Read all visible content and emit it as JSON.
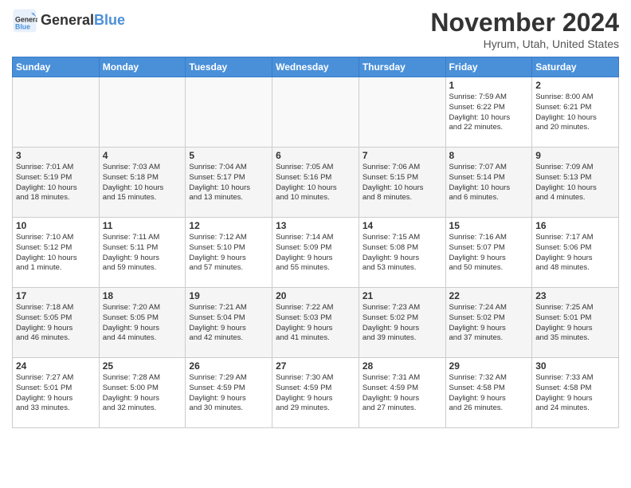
{
  "header": {
    "logo_line1": "General",
    "logo_line2": "Blue",
    "month": "November 2024",
    "location": "Hyrum, Utah, United States"
  },
  "columns": [
    "Sunday",
    "Monday",
    "Tuesday",
    "Wednesday",
    "Thursday",
    "Friday",
    "Saturday"
  ],
  "weeks": [
    [
      {
        "day": "",
        "info": ""
      },
      {
        "day": "",
        "info": ""
      },
      {
        "day": "",
        "info": ""
      },
      {
        "day": "",
        "info": ""
      },
      {
        "day": "",
        "info": ""
      },
      {
        "day": "1",
        "info": "Sunrise: 7:59 AM\nSunset: 6:22 PM\nDaylight: 10 hours\nand 22 minutes."
      },
      {
        "day": "2",
        "info": "Sunrise: 8:00 AM\nSunset: 6:21 PM\nDaylight: 10 hours\nand 20 minutes."
      }
    ],
    [
      {
        "day": "3",
        "info": "Sunrise: 7:01 AM\nSunset: 5:19 PM\nDaylight: 10 hours\nand 18 minutes."
      },
      {
        "day": "4",
        "info": "Sunrise: 7:03 AM\nSunset: 5:18 PM\nDaylight: 10 hours\nand 15 minutes."
      },
      {
        "day": "5",
        "info": "Sunrise: 7:04 AM\nSunset: 5:17 PM\nDaylight: 10 hours\nand 13 minutes."
      },
      {
        "day": "6",
        "info": "Sunrise: 7:05 AM\nSunset: 5:16 PM\nDaylight: 10 hours\nand 10 minutes."
      },
      {
        "day": "7",
        "info": "Sunrise: 7:06 AM\nSunset: 5:15 PM\nDaylight: 10 hours\nand 8 minutes."
      },
      {
        "day": "8",
        "info": "Sunrise: 7:07 AM\nSunset: 5:14 PM\nDaylight: 10 hours\nand 6 minutes."
      },
      {
        "day": "9",
        "info": "Sunrise: 7:09 AM\nSunset: 5:13 PM\nDaylight: 10 hours\nand 4 minutes."
      }
    ],
    [
      {
        "day": "10",
        "info": "Sunrise: 7:10 AM\nSunset: 5:12 PM\nDaylight: 10 hours\nand 1 minute."
      },
      {
        "day": "11",
        "info": "Sunrise: 7:11 AM\nSunset: 5:11 PM\nDaylight: 9 hours\nand 59 minutes."
      },
      {
        "day": "12",
        "info": "Sunrise: 7:12 AM\nSunset: 5:10 PM\nDaylight: 9 hours\nand 57 minutes."
      },
      {
        "day": "13",
        "info": "Sunrise: 7:14 AM\nSunset: 5:09 PM\nDaylight: 9 hours\nand 55 minutes."
      },
      {
        "day": "14",
        "info": "Sunrise: 7:15 AM\nSunset: 5:08 PM\nDaylight: 9 hours\nand 53 minutes."
      },
      {
        "day": "15",
        "info": "Sunrise: 7:16 AM\nSunset: 5:07 PM\nDaylight: 9 hours\nand 50 minutes."
      },
      {
        "day": "16",
        "info": "Sunrise: 7:17 AM\nSunset: 5:06 PM\nDaylight: 9 hours\nand 48 minutes."
      }
    ],
    [
      {
        "day": "17",
        "info": "Sunrise: 7:18 AM\nSunset: 5:05 PM\nDaylight: 9 hours\nand 46 minutes."
      },
      {
        "day": "18",
        "info": "Sunrise: 7:20 AM\nSunset: 5:05 PM\nDaylight: 9 hours\nand 44 minutes."
      },
      {
        "day": "19",
        "info": "Sunrise: 7:21 AM\nSunset: 5:04 PM\nDaylight: 9 hours\nand 42 minutes."
      },
      {
        "day": "20",
        "info": "Sunrise: 7:22 AM\nSunset: 5:03 PM\nDaylight: 9 hours\nand 41 minutes."
      },
      {
        "day": "21",
        "info": "Sunrise: 7:23 AM\nSunset: 5:02 PM\nDaylight: 9 hours\nand 39 minutes."
      },
      {
        "day": "22",
        "info": "Sunrise: 7:24 AM\nSunset: 5:02 PM\nDaylight: 9 hours\nand 37 minutes."
      },
      {
        "day": "23",
        "info": "Sunrise: 7:25 AM\nSunset: 5:01 PM\nDaylight: 9 hours\nand 35 minutes."
      }
    ],
    [
      {
        "day": "24",
        "info": "Sunrise: 7:27 AM\nSunset: 5:01 PM\nDaylight: 9 hours\nand 33 minutes."
      },
      {
        "day": "25",
        "info": "Sunrise: 7:28 AM\nSunset: 5:00 PM\nDaylight: 9 hours\nand 32 minutes."
      },
      {
        "day": "26",
        "info": "Sunrise: 7:29 AM\nSunset: 4:59 PM\nDaylight: 9 hours\nand 30 minutes."
      },
      {
        "day": "27",
        "info": "Sunrise: 7:30 AM\nSunset: 4:59 PM\nDaylight: 9 hours\nand 29 minutes."
      },
      {
        "day": "28",
        "info": "Sunrise: 7:31 AM\nSunset: 4:59 PM\nDaylight: 9 hours\nand 27 minutes."
      },
      {
        "day": "29",
        "info": "Sunrise: 7:32 AM\nSunset: 4:58 PM\nDaylight: 9 hours\nand 26 minutes."
      },
      {
        "day": "30",
        "info": "Sunrise: 7:33 AM\nSunset: 4:58 PM\nDaylight: 9 hours\nand 24 minutes."
      }
    ]
  ]
}
